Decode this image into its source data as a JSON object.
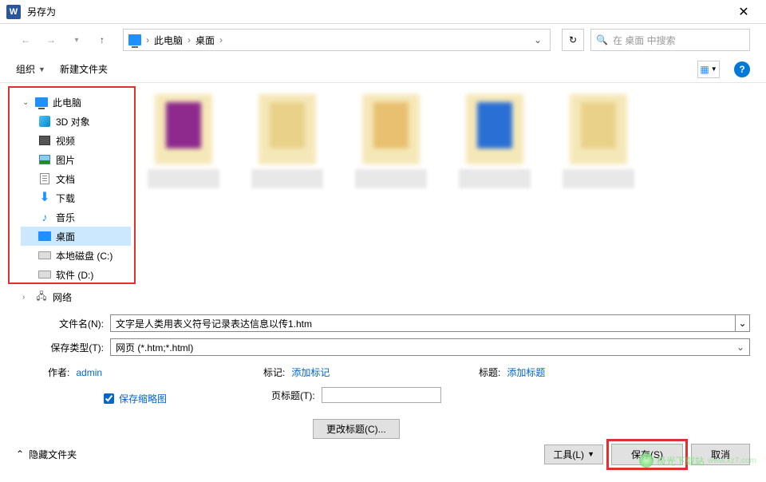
{
  "window": {
    "title": "另存为",
    "app_icon_letter": "W"
  },
  "nav": {
    "breadcrumb": {
      "pc": "此电脑",
      "desktop": "桌面"
    },
    "search_placeholder": "在 桌面 中搜索"
  },
  "toolbar": {
    "organize": "组织",
    "new_folder": "新建文件夹",
    "help": "?"
  },
  "tree": {
    "this_pc": "此电脑",
    "objects_3d": "3D 对象",
    "videos": "视频",
    "pictures": "图片",
    "documents": "文档",
    "downloads": "下载",
    "music": "音乐",
    "desktop": "桌面",
    "local_disk_c": "本地磁盘 (C:)",
    "software_d": "软件 (D:)",
    "network": "网络"
  },
  "form": {
    "filename_label": "文件名(N):",
    "filename_value": "文字是人类用表义符号记录表达信息以传1.htm",
    "filetype_label": "保存类型(T):",
    "filetype_value": "网页 (*.htm;*.html)"
  },
  "meta": {
    "author_label": "作者:",
    "author_value": "admin",
    "tag_label": "标记:",
    "tag_link": "添加标记",
    "title_label": "标题:",
    "title_link": "添加标题",
    "save_thumb": "保存缩略图",
    "page_title_label": "页标题(T):",
    "change_title_btn": "更改标题(C)..."
  },
  "footer": {
    "hide_folders": "隐藏文件夹",
    "tools": "工具(L)",
    "save": "保存(S)",
    "cancel": "取消"
  },
  "watermark": "极光下载站",
  "thumb_colors": [
    "#8e2a8e",
    "#d4a020",
    "#d4a020",
    "#2a6fd4",
    "#d4a020"
  ]
}
